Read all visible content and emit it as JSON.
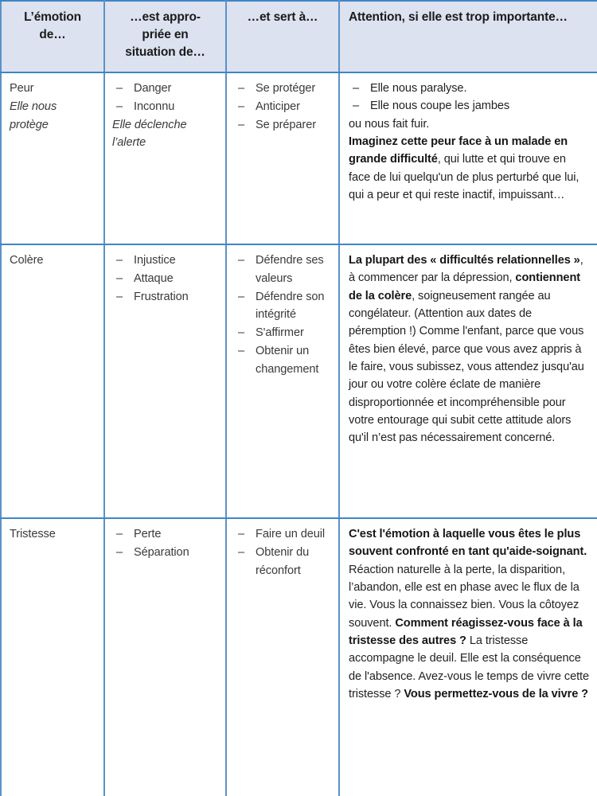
{
  "table": {
    "headers": [
      "L’émotion de…",
      "…est appro-priée en situation de…",
      "…et sert à…",
      "Attention, si elle est trop importante…"
    ],
    "header_lines": {
      "col1": [
        "L’émotion",
        "de…"
      ],
      "col2": [
        "…est appro-",
        "priée en",
        "situation de…"
      ],
      "col3": [
        "…et sert à…"
      ],
      "col4": [
        "Attention, si elle est trop importante…"
      ]
    },
    "rows": [
      {
        "emotion": {
          "name": "Peur",
          "subtitle_lines": [
            "Elle nous",
            "protège"
          ]
        },
        "situations": {
          "items": [
            "Danger",
            "Inconnu"
          ],
          "note_lines": [
            "Elle déclenche",
            "l’alerte"
          ]
        },
        "purpose": {
          "items": [
            "Se protéger",
            "Anticiper",
            "Se préparer"
          ]
        },
        "warning": {
          "items": [
            "Elle nous paralyse.",
            "Elle nous coupe les jambes"
          ],
          "items_continuation": "ou nous fait fuir.",
          "paragraph": {
            "bold_lead": "Imaginez cette peur face à un malade en grande difficulté",
            "rest": ", qui lutte et qui trouve en face de lui quelqu'un de plus perturbé que lui, qui a peur et qui reste inactif, impuissant…"
          }
        }
      },
      {
        "emotion": {
          "name": "Colère",
          "subtitle_lines": []
        },
        "situations": {
          "items": [
            "Injustice",
            "Attaque",
            "Frustration"
          ],
          "note_lines": []
        },
        "purpose": {
          "items": [
            "Défendre ses valeurs",
            "Défendre son intégrité",
            "S'affirmer",
            "Obtenir un changement"
          ]
        },
        "warning": {
          "items": [],
          "items_continuation": "",
          "paragraph": {
            "bold_lead": "La plupart des « difficultés relationnelles »",
            "middle": ", à commencer par la dépression, ",
            "bold_mid": "contiennent de la colère",
            "rest": ", soigneusement rangée au congélateur. (Attention aux dates de péremption !) Comme l'enfant, parce que vous êtes bien élevé, parce que vous avez appris à le faire, vous subissez, vous attendez jusqu'au jour ou votre colère éclate de manière disproportionnée et incompréhensible pour votre entourage qui subit cette attitude alors qu'il n’est pas nécessairement concerné."
          }
        }
      },
      {
        "emotion": {
          "name": "Tristesse",
          "subtitle_lines": []
        },
        "situations": {
          "items": [
            "Perte",
            "Séparation"
          ],
          "note_lines": []
        },
        "purpose": {
          "items": [
            "Faire un deuil",
            "Obtenir du réconfort"
          ]
        },
        "warning": {
          "items": [],
          "items_continuation": "",
          "paragraph": {
            "bold_lead": "C'est l'émotion à laquelle vous êtes le plus souvent confronté en tant qu'aide-soignant.",
            "middle": " Réaction naturelle à la perte, la disparition, l’abandon, elle est en phase avec le flux de la vie. Vous la connaissez bien. Vous la côtoyez souvent. ",
            "bold_mid": "Comment réagissez-vous face à la tristesse des autres ?",
            "rest": " La tristesse accompagne le deuil. Elle est la conséquence de l'absence. Avez-vous le temps de vivre cette tristesse ? ",
            "bold_tail": "Vous permettez-vous de la vivre ?"
          }
        }
      }
    ]
  },
  "colors": {
    "header_background": "#dde2f0",
    "border": "#3f86c4",
    "border_light": "#5b92c6",
    "body_text": "#3a3a3c",
    "bold_text": "#161616"
  }
}
